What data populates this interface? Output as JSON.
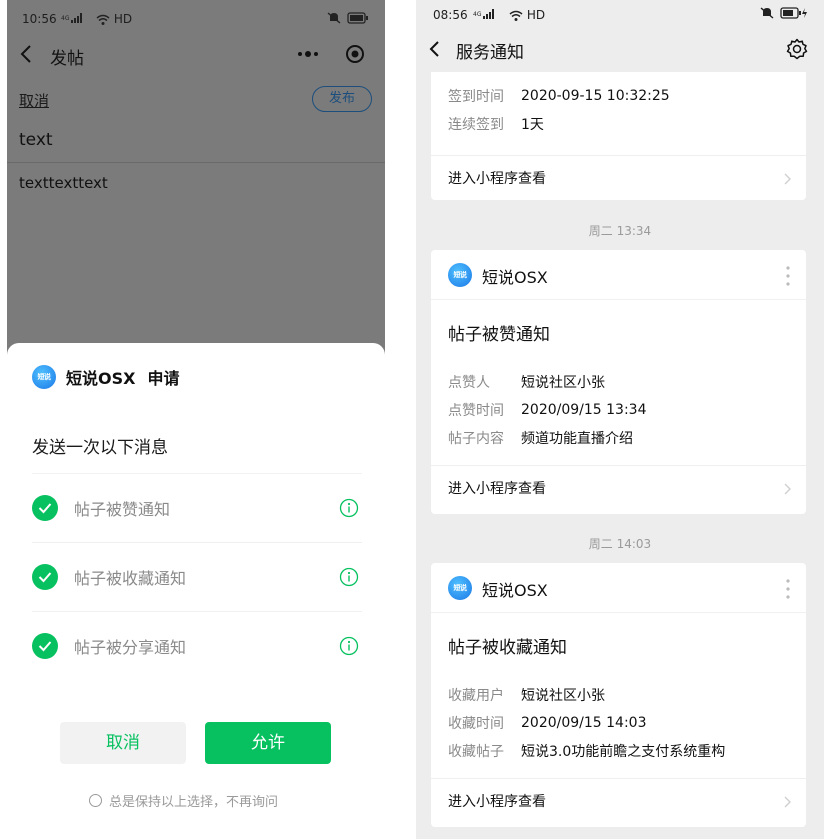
{
  "left": {
    "status": {
      "time": "10:56",
      "signal": "4G",
      "hd": "HD"
    },
    "nav": {
      "title": "发帖"
    },
    "editor": {
      "cancel_label": "取消",
      "publish_label": "发布",
      "title_value": "text",
      "body_value": "texttexttext"
    },
    "sheet": {
      "app_logo_text": "短说",
      "app_name": "短说OSX",
      "apply_label": "申请",
      "subtitle": "发送一次以下消息",
      "permissions": [
        {
          "label": "帖子被赞通知"
        },
        {
          "label": "帖子被收藏通知"
        },
        {
          "label": "帖子被分享通知"
        }
      ],
      "deny_label": "取消",
      "allow_label": "允许",
      "remember_label": "总是保持以上选择，不再询问"
    }
  },
  "right": {
    "status": {
      "time": "08:56",
      "signal": "4G",
      "hd": "HD"
    },
    "nav": {
      "title": "服务通知"
    },
    "partial_card": {
      "rows": [
        {
          "key": "签到时间",
          "value": "2020-09-15 10:32:25"
        },
        {
          "key": "连续签到",
          "value": "1天"
        }
      ],
      "footer_label": "进入小程序查看"
    },
    "cards": [
      {
        "timestamp": "周二 13:34",
        "app_logo_text": "短说",
        "app_name": "短说OSX",
        "title": "帖子被赞通知",
        "rows": [
          {
            "key": "点赞人",
            "value": "短说社区小张"
          },
          {
            "key": "点赞时间",
            "value": "2020/09/15 13:34"
          },
          {
            "key": "帖子内容",
            "value": "频道功能直播介绍"
          }
        ],
        "footer_label": "进入小程序查看"
      },
      {
        "timestamp": "周二 14:03",
        "app_logo_text": "短说",
        "app_name": "短说OSX",
        "title": "帖子被收藏通知",
        "rows": [
          {
            "key": "收藏用户",
            "value": "短说社区小张"
          },
          {
            "key": "收藏时间",
            "value": "2020/09/15 14:03"
          },
          {
            "key": "收藏帖子",
            "value": "短说3.0功能前瞻之支付系统重构"
          }
        ],
        "footer_label": "进入小程序查看"
      }
    ]
  },
  "colors": {
    "accent_green": "#07c160",
    "link_blue": "#1c4e7d",
    "overlay_gray": "#7b7b7b",
    "feed_bg": "#ededed"
  }
}
